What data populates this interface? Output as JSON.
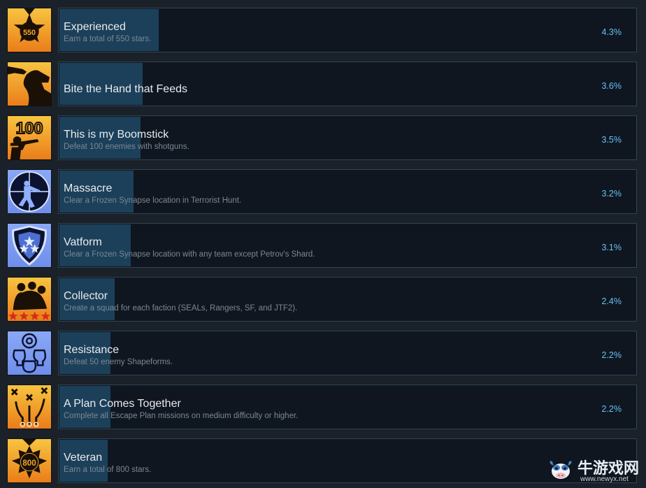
{
  "achievements": [
    {
      "title": "Experienced",
      "description": "Earn a total of 550 stars.",
      "percent": "4.3%",
      "percent_value": 4.3,
      "icon": "medal-550-icon",
      "icon_text": "550",
      "theme": "orange"
    },
    {
      "title": "Bite the Hand that Feeds",
      "description": "",
      "percent": "3.6%",
      "percent_value": 3.6,
      "icon": "dog-bite-hand-icon",
      "theme": "orange"
    },
    {
      "title": "This is my Boomstick",
      "description": "Defeat 100 enemies with shotguns.",
      "percent": "3.5%",
      "percent_value": 3.5,
      "icon": "shotgun-100-icon",
      "icon_text": "100",
      "theme": "orange"
    },
    {
      "title": "Massacre",
      "description": "Clear a Frozen Synapse location in Terrorist Hunt.",
      "percent": "3.2%",
      "percent_value": 3.2,
      "icon": "crosshair-soldier-icon",
      "theme": "blue"
    },
    {
      "title": "Vatform",
      "description": "Clear a Frozen Synapse location with any team except Petrov's Shard.",
      "percent": "3.1%",
      "percent_value": 3.1,
      "icon": "shield-stars-icon",
      "theme": "blue"
    },
    {
      "title": "Collector",
      "description": "Create a squad for each faction (SEALs, Rangers, SF, and JTF2).",
      "percent": "2.4%",
      "percent_value": 2.4,
      "icon": "squad-stars-icon",
      "theme": "orange"
    },
    {
      "title": "Resistance",
      "description": "Defeat 50 enemy Shapeforms.",
      "percent": "2.2%",
      "percent_value": 2.2,
      "icon": "skulls-icon",
      "theme": "blue"
    },
    {
      "title": "A Plan Comes Together",
      "description": "Complete all Escape Plan missions on medium difficulty or higher.",
      "percent": "2.2%",
      "percent_value": 2.2,
      "icon": "tactical-plan-icon",
      "theme": "orange"
    },
    {
      "title": "Veteran",
      "description": "Earn a total of 800 stars.",
      "percent": "",
      "percent_value": 2.1,
      "icon": "medal-800-icon",
      "icon_text": "800",
      "theme": "orange"
    }
  ],
  "watermark": {
    "site_name": "牛游戏网",
    "url": "www.newyx.net",
    "icon": "cow-mascot-icon"
  },
  "colors": {
    "background": "#1b2129",
    "panel": "#0f1620",
    "panel_border": "#2e4455",
    "progress_fill": "#1c4059",
    "percent_text": "#66c0f4",
    "icon_orange": "#f2a42c",
    "icon_blue": "#7d9df0"
  }
}
